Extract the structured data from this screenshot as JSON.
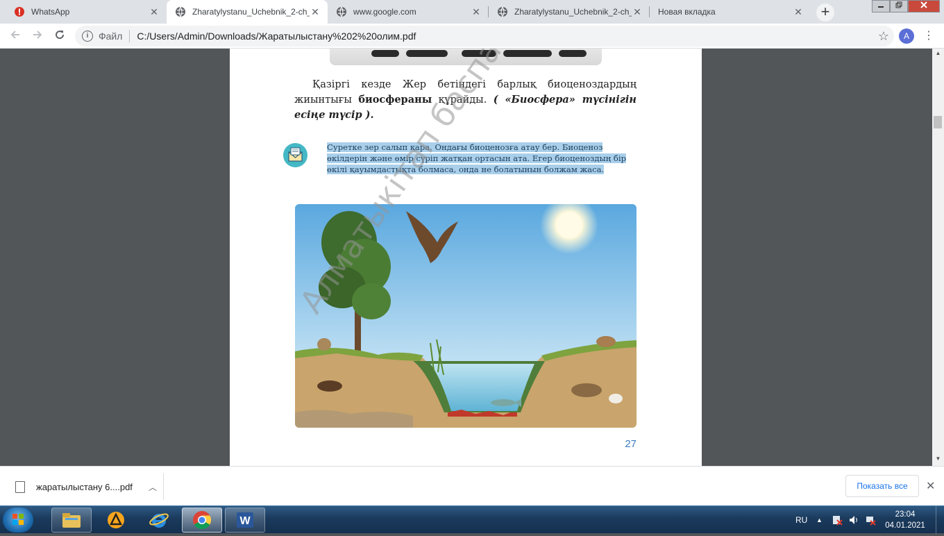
{
  "browser": {
    "tabs": [
      {
        "title": "WhatsApp",
        "favicon": "whatsapp-alert-icon",
        "active": false
      },
      {
        "title": "Zharatylystanu_Uchebnik_2-ch_",
        "favicon": "globe-icon",
        "active": true
      },
      {
        "title": "www.google.com",
        "favicon": "globe-icon",
        "active": false
      },
      {
        "title": "Zharatylystanu_Uchebnik_2-ch_",
        "favicon": "globe-icon",
        "active": false
      },
      {
        "title": "Новая вкладка",
        "favicon": "none",
        "active": false
      }
    ],
    "tab_close_glyph": "✕",
    "new_tab_glyph": "+",
    "address": {
      "scheme_label": "Файл",
      "url": "C:/Users/Admin/Downloads/Жаратылыстану%202%20олим.pdf"
    },
    "profile_initial": "A"
  },
  "pdf": {
    "paragraph": {
      "part1": "Қазіргі кезде Жер бетіндегі барлық биоценоздардың жиынтығы ",
      "bold": "биосфераны",
      "part2": " құрайды. ",
      "italic": "( «Биосфера» түсінігін есіңе түсір )."
    },
    "task_text": "Суретке зер салып қара. Ондағы биоценозға атау бер. Биоценоз өкілдерін және өмір сүріп жатқан ортасын ата. Егер биоценоздың бір өкілі қауымдастықта болмаса, онда не болатынын болжам жаса.",
    "page_number": "27",
    "watermark": "Алматыкітап баспасы"
  },
  "downloads": {
    "file_name": "жаратылыстану 6....pdf",
    "show_all_label": "Показать все"
  },
  "taskbar": {
    "language": "RU",
    "time": "23:04",
    "date": "04.01.2021"
  },
  "colors": {
    "accent_blue": "#1a73e8",
    "page_number": "#3a7cc1",
    "highlight": "#a9cfea",
    "task_icon": "#45b8c5"
  }
}
